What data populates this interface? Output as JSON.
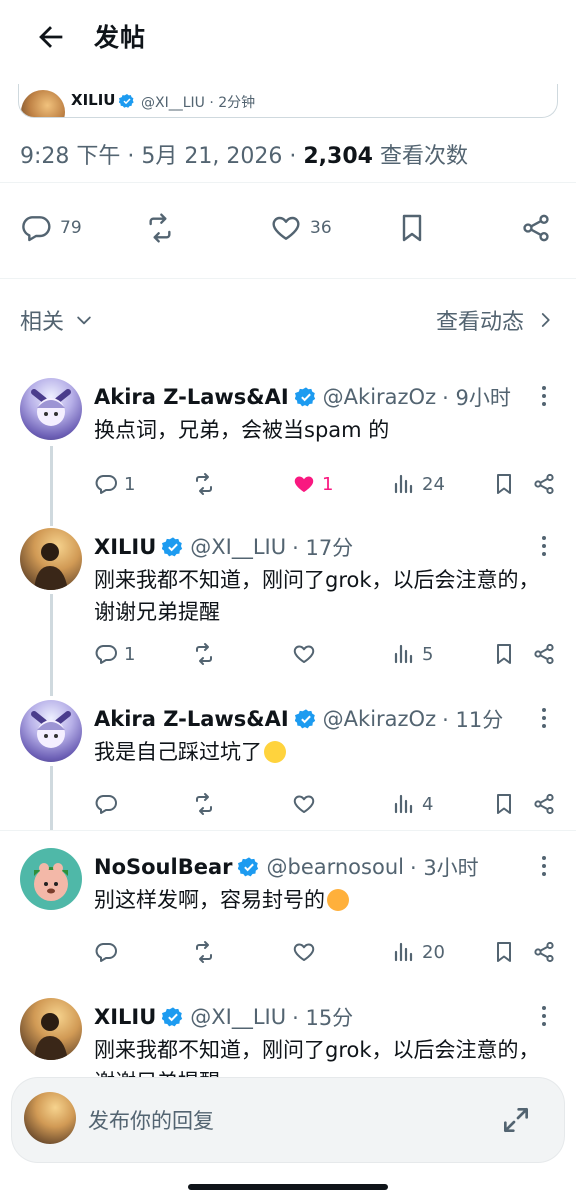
{
  "header": {
    "title": "发帖"
  },
  "quoted": {
    "name": "XILIU",
    "handle_time": "@XI__LIU · 2分钟"
  },
  "meta": {
    "time": "9:28 下午",
    "date": "5月 21, 2026",
    "views": "2,304",
    "views_label": "查看次数"
  },
  "actions": {
    "replies": "79",
    "likes": "36"
  },
  "related": {
    "label": "相关",
    "view_activity": "查看动态"
  },
  "replies": [
    {
      "name": "Akira Z-Laws&AI",
      "handle": "@AkirazOz",
      "time": "· 9小时",
      "text": "换点词，兄弟，会被当spam 的",
      "replies": "1",
      "retweets": "",
      "likes": "1",
      "views": "24",
      "liked": true
    },
    {
      "name": "XILIU",
      "handle": "@XI__LIU",
      "time": "· 17分",
      "text": "刚来我都不知道，刚问了grok，以后会注意的，谢谢兄弟提醒",
      "replies": "1",
      "retweets": "",
      "likes": "",
      "views": "5"
    },
    {
      "name": "Akira Z-Laws&AI",
      "handle": "@AkirazOz",
      "time": "· 11分",
      "text": "我是自己踩过坑了",
      "replies": "",
      "retweets": "",
      "likes": "",
      "views": "4"
    },
    {
      "name": "NoSoulBear",
      "handle": "@bearnosoul",
      "time": "· 3小时",
      "text": "别这样发啊，容易封号的",
      "replies": "",
      "retweets": "",
      "likes": "",
      "views": "20"
    },
    {
      "name": "XILIU",
      "handle": "@XI__LIU",
      "time": "· 15分",
      "text": "刚来我都不知道，刚问了grok，以后会注意的，谢谢兄弟提醒"
    }
  ],
  "compose": {
    "placeholder": "发布你的回复"
  },
  "colors": {
    "accent": "#1d9bf0",
    "like": "#f91880",
    "text": "#0f1419",
    "secondary": "#536471"
  }
}
